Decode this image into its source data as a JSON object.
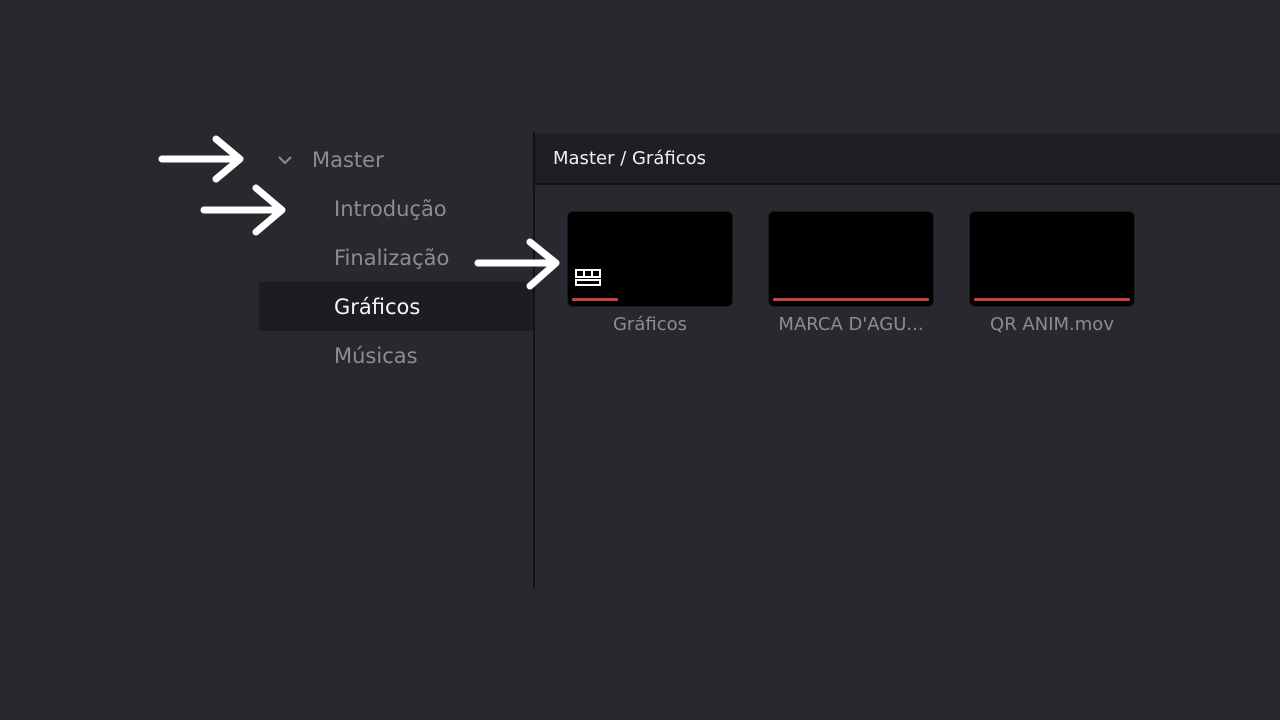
{
  "tree": {
    "master_label": "Master",
    "items": [
      {
        "label": "Introdução",
        "selected": false
      },
      {
        "label": "Finalização",
        "selected": false
      },
      {
        "label": "Gráficos",
        "selected": true
      },
      {
        "label": "Músicas",
        "selected": false
      }
    ]
  },
  "header": {
    "breadcrumb": "Master / Gráficos"
  },
  "clips": [
    {
      "name": "Gráficos",
      "type": "bin",
      "icon": "bin-grid-icon"
    },
    {
      "name": "MARCA D'AGU...",
      "type": "media"
    },
    {
      "name": "QR ANIM.mov",
      "type": "media"
    }
  ],
  "colors": {
    "background": "#28282e",
    "selected_row": "#1c1d21",
    "clip_bar": "#c8413b",
    "annotation_arrow": "#ffffff"
  }
}
